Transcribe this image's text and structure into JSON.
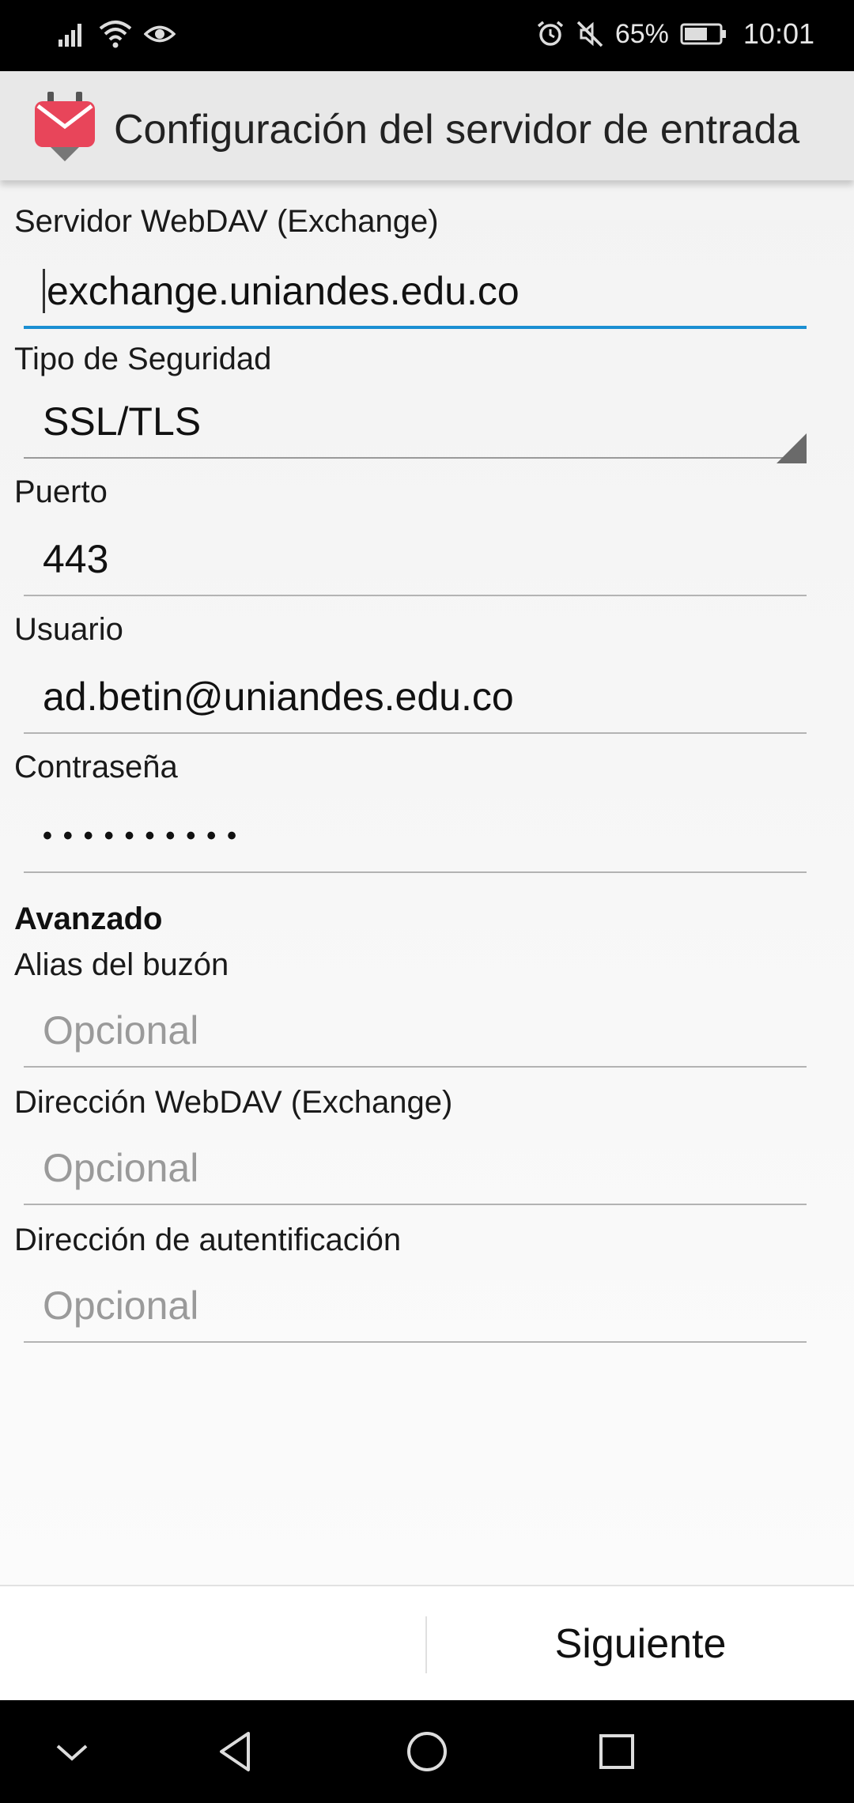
{
  "status_bar": {
    "battery_percent": "65%",
    "time": "10:01",
    "icons": [
      "signal-icon",
      "wifi-icon",
      "eye-icon",
      "alarm-icon",
      "mute-icon",
      "battery-icon"
    ]
  },
  "app_bar": {
    "title": "Configuración del servidor de entrada",
    "logo": "k9-mail-logo"
  },
  "form": {
    "server": {
      "label": "Servidor WebDAV (Exchange)",
      "value": "exchange.uniandes.edu.co"
    },
    "security": {
      "label": "Tipo de Seguridad",
      "value": "SSL/TLS"
    },
    "port": {
      "label": "Puerto",
      "value": "443"
    },
    "user": {
      "label": "Usuario",
      "value": "ad.betin@uniandes.edu.co"
    },
    "password": {
      "label": "Contraseña",
      "value": "••••••••••"
    },
    "advanced": {
      "title": "Avanzado"
    },
    "mailbox_alias": {
      "label": "Alias del buzón",
      "placeholder": "Opcional"
    },
    "webdav_path": {
      "label": "Dirección WebDAV (Exchange)",
      "placeholder": "Opcional"
    },
    "auth_path": {
      "label": "Dirección de autentificación",
      "placeholder": "Opcional"
    }
  },
  "buttons": {
    "next": "Siguiente"
  },
  "colors": {
    "focus_accent": "#1a8fd2",
    "logo_red": "#e8455a"
  }
}
